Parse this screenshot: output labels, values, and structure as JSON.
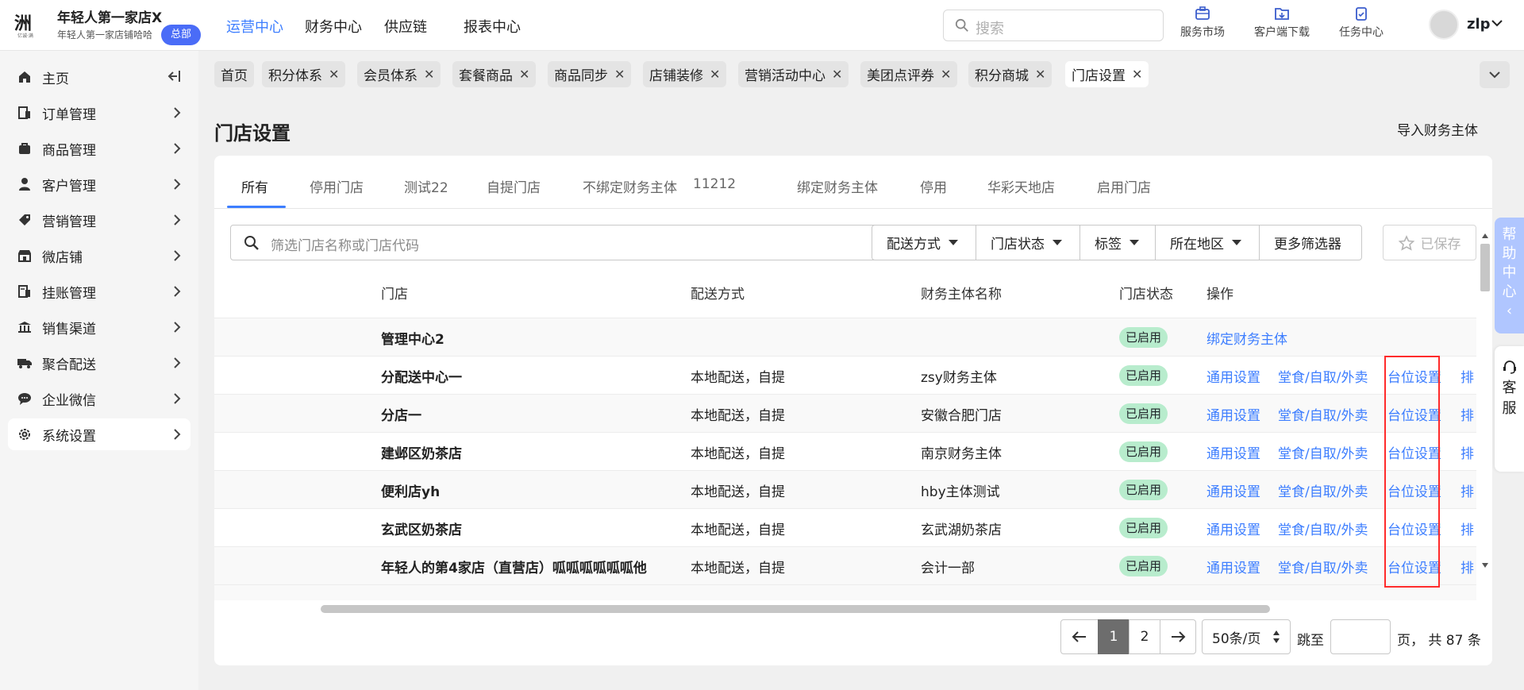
{
  "brand": {
    "title": "年轻人第一家店X",
    "subtitle": "年轻人第一家店铺哈哈",
    "badge": "总部",
    "logo_text": "洲",
    "logo_sub": "亿诚·满"
  },
  "topnav": [
    {
      "label": "运营中心",
      "active": true
    },
    {
      "label": "财务中心",
      "active": false
    },
    {
      "label": "供应链",
      "active": false
    },
    {
      "label": "报表中心",
      "active": false
    }
  ],
  "search": {
    "placeholder": "搜索"
  },
  "tools": [
    {
      "label": "服务市场",
      "icon": "briefcase-icon"
    },
    {
      "label": "客户端下载",
      "icon": "download-folder-icon"
    },
    {
      "label": "任务中心",
      "icon": "clipboard-icon"
    }
  ],
  "user": {
    "name": "zlp"
  },
  "sidebar": {
    "items": [
      {
        "label": "主页",
        "icon": "home-icon"
      },
      {
        "label": "订单管理",
        "icon": "order-icon"
      },
      {
        "label": "商品管理",
        "icon": "goods-icon"
      },
      {
        "label": "客户管理",
        "icon": "user-icon"
      },
      {
        "label": "营销管理",
        "icon": "tag-icon"
      },
      {
        "label": "微店铺",
        "icon": "shop-icon"
      },
      {
        "label": "挂账管理",
        "icon": "ledger-icon"
      },
      {
        "label": "销售渠道",
        "icon": "bank-icon"
      },
      {
        "label": "聚合配送",
        "icon": "truck-icon"
      },
      {
        "label": "企业微信",
        "icon": "chat-icon"
      },
      {
        "label": "系统设置",
        "icon": "gear-icon"
      }
    ]
  },
  "page_tabs": [
    {
      "label": "首页",
      "closable": false
    },
    {
      "label": "积分体系",
      "closable": true
    },
    {
      "label": "会员体系",
      "closable": true
    },
    {
      "label": "套餐商品",
      "closable": true
    },
    {
      "label": "商品同步",
      "closable": true
    },
    {
      "label": "店铺装修",
      "closable": true
    },
    {
      "label": "营销活动中心",
      "closable": true
    },
    {
      "label": "美团点评券",
      "closable": true
    },
    {
      "label": "积分商城",
      "closable": true
    },
    {
      "label": "门店设置",
      "closable": true,
      "active": true
    }
  ],
  "page": {
    "title": "门店设置",
    "import_label": "导入财务主体"
  },
  "filter_tabs": [
    "所有",
    "停用门店",
    "测试22",
    "自提门店",
    "不绑定财务主体",
    "11212",
    "绑定财务主体",
    "停用",
    "华彩天地店",
    "启用门店"
  ],
  "filters": {
    "search_placeholder": "筛选门店名称或门店代码",
    "dropdowns": [
      "配送方式",
      "门店状态",
      "标签",
      "所在地区"
    ],
    "more": "更多筛选器",
    "saved": "已保存"
  },
  "table": {
    "headers": [
      "门店",
      "配送方式",
      "财务主体名称",
      "门店状态",
      "操作"
    ],
    "rows": [
      {
        "store": "管理中心2",
        "delivery": "",
        "entity": "",
        "status": "已启用",
        "ops": [
          "绑定财务主体"
        ]
      },
      {
        "store": "分配送中心一",
        "delivery": "本地配送，自提",
        "entity": "zsy财务主体",
        "status": "已启用",
        "ops": [
          "通用设置",
          "堂食/自取/外卖",
          "台位设置",
          "排"
        ]
      },
      {
        "store": "分店一",
        "delivery": "本地配送，自提",
        "entity": "安徽合肥门店",
        "status": "已启用",
        "ops": [
          "通用设置",
          "堂食/自取/外卖",
          "台位设置",
          "排"
        ]
      },
      {
        "store": "建邺区奶茶店",
        "delivery": "本地配送，自提",
        "entity": "南京财务主体",
        "status": "已启用",
        "ops": [
          "通用设置",
          "堂食/自取/外卖",
          "台位设置",
          "排"
        ]
      },
      {
        "store": "便利店yh",
        "delivery": "本地配送，自提",
        "entity": "hby主体测试",
        "status": "已启用",
        "ops": [
          "通用设置",
          "堂食/自取/外卖",
          "台位设置",
          "排"
        ]
      },
      {
        "store": "玄武区奶茶店",
        "delivery": "本地配送，自提",
        "entity": "玄武湖奶茶店",
        "status": "已启用",
        "ops": [
          "通用设置",
          "堂食/自取/外卖",
          "台位设置",
          "排"
        ]
      },
      {
        "store": "年轻人的第4家店（直营店）呱呱呱呱呱呱他",
        "delivery": "本地配送，自提",
        "entity": "会计一部",
        "status": "已启用",
        "ops": [
          "通用设置",
          "堂食/自取/外卖",
          "台位设置",
          "排"
        ]
      }
    ]
  },
  "pagination": {
    "pages": [
      "1",
      "2"
    ],
    "current": "1",
    "per_page": "50条/页",
    "jump_label": "跳至",
    "total_text": "页， 共 87 条"
  },
  "floating": {
    "help": [
      "帮",
      "助",
      "中",
      "心"
    ],
    "service": [
      "客",
      "服"
    ]
  },
  "colors": {
    "accent": "#3d7eff",
    "badge": "#4a6cf7",
    "status_bg": "#b8eccd",
    "highlight": "#ff2b2b"
  }
}
